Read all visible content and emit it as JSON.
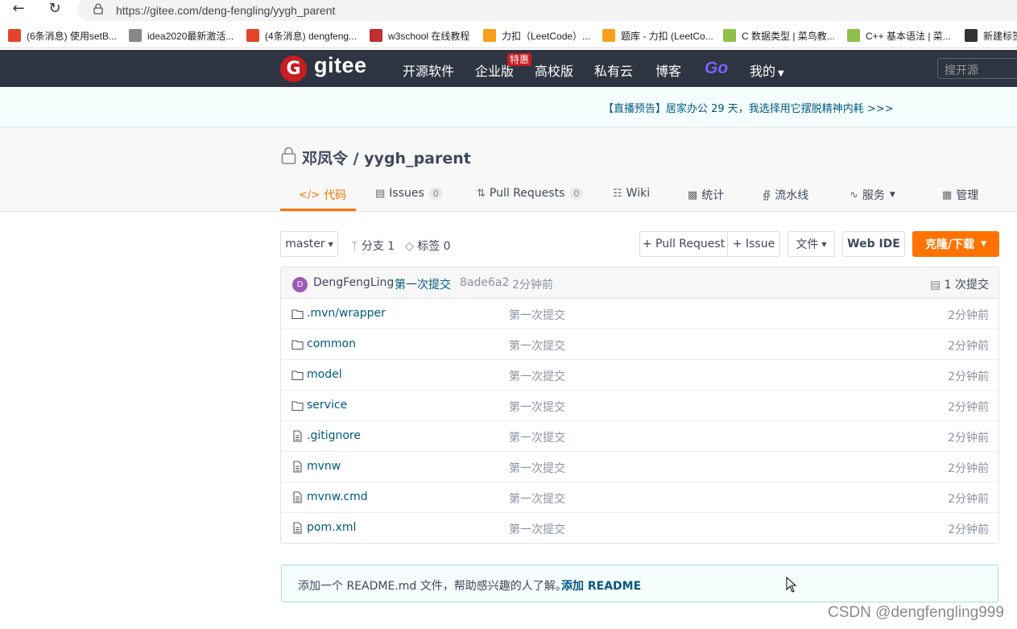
{
  "browser": {
    "url": "https://gitee.com/deng-fengling/yygh_parent",
    "bookmarks": [
      {
        "label": "(6条消息) 使用setB...",
        "color": "#e4442c"
      },
      {
        "label": "idea2020最新激活...",
        "color": "#888888"
      },
      {
        "label": "(4条消息) dengfeng...",
        "color": "#e4442c"
      },
      {
        "label": "w3school 在线教程",
        "color": "#c02f2f"
      },
      {
        "label": "力扣（LeetCode）...",
        "color": "#f89f1b"
      },
      {
        "label": "题库 - 力扣 (LeetCo...",
        "color": "#f89f1b"
      },
      {
        "label": "C 数据类型 | 菜鸟教...",
        "color": "#8ec04b"
      },
      {
        "label": "C++ 基本语法 | 菜...",
        "color": "#8ec04b"
      },
      {
        "label": "新建标签",
        "color": "#333333"
      }
    ]
  },
  "header": {
    "logo_letter": "G",
    "logo_text": "gitee",
    "nav": [
      "开源软件",
      "企业版",
      "高校版",
      "私有云",
      "博客"
    ],
    "special_badge": "特惠",
    "go_label": "Go",
    "my_label": "我的",
    "search_placeholder": "搜开源"
  },
  "banner": {
    "text": "【直播预告】居家办公 29 天，我选择用它摆脱精神内耗 >>>"
  },
  "repo": {
    "title": "邓凤令 / yygh_parent",
    "tabs": {
      "code": "代码",
      "issues": "Issues",
      "issues_count": "0",
      "pulls": "Pull Requests",
      "pulls_count": "0",
      "wiki": "Wiki",
      "stats": "统计",
      "pipeline": "流水线",
      "services": "服务",
      "manage": "管理"
    }
  },
  "toolbar": {
    "branch": "master",
    "branches": "分支 1",
    "tags": "标签 0",
    "pull_request": "+ Pull Request",
    "issue": "+ Issue",
    "file": "文件",
    "web_ide": "Web IDE",
    "clone": "克隆/下载"
  },
  "commit": {
    "avatar_letter": "D",
    "author": "DengFengLing",
    "message": "第一次提交",
    "hash": "8ade6a2",
    "time": "2分钟前",
    "count": "1 次提交"
  },
  "files": [
    {
      "name": ".mvn/wrapper",
      "type": "folder",
      "msg": "第一次提交",
      "time": "2分钟前"
    },
    {
      "name": "common",
      "type": "folder",
      "msg": "第一次提交",
      "time": "2分钟前"
    },
    {
      "name": "model",
      "type": "folder",
      "msg": "第一次提交",
      "time": "2分钟前"
    },
    {
      "name": "service",
      "type": "folder",
      "msg": "第一次提交",
      "time": "2分钟前"
    },
    {
      "name": ".gitignore",
      "type": "file",
      "msg": "第一次提交",
      "time": "2分钟前"
    },
    {
      "name": "mvnw",
      "type": "file",
      "msg": "第一次提交",
      "time": "2分钟前"
    },
    {
      "name": "mvnw.cmd",
      "type": "file",
      "msg": "第一次提交",
      "time": "2分钟前"
    },
    {
      "name": "pom.xml",
      "type": "file",
      "msg": "第一次提交",
      "time": "2分钟前"
    }
  ],
  "readme": {
    "text": "添加一个 README.md 文件，帮助感兴趣的人了解。",
    "link": "添加 README"
  },
  "watermark": "CSDN @dengfengling999"
}
